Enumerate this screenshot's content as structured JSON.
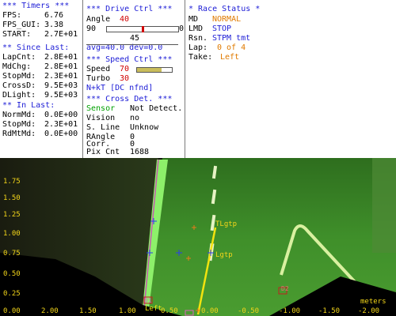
{
  "timers": {
    "header": "*** Timers ***",
    "fps_label": "FPS:",
    "fps": "6.76",
    "fps_gui_label": "FPS_GUI:",
    "fps_gui": "3.38",
    "start_label": "START:",
    "start": "2.7E+01"
  },
  "since_last": {
    "header": "** Since Last:",
    "items": [
      {
        "label": "LapCnt:",
        "value": "2.8E+01"
      },
      {
        "label": "MdChg:",
        "value": "2.8E+01"
      },
      {
        "label": "StopMd:",
        "value": "2.3E+01"
      },
      {
        "label": "CrossD:",
        "value": "9.5E+03"
      },
      {
        "label": "DLight:",
        "value": "9.5E+03"
      }
    ]
  },
  "in_last": {
    "header": "** In Last:",
    "items": [
      {
        "label": "NormMd:",
        "value": "0.0E+00"
      },
      {
        "label": "StopMd:",
        "value": "2.3E+01"
      },
      {
        "label": "RdMtMd:",
        "value": "0.0E+00"
      }
    ]
  },
  "drive": {
    "header": "*** Drive Ctrl ***",
    "angle_label": "Angle",
    "angle": "40",
    "slider_min": "90",
    "slider_max": "0",
    "slider_value": 45,
    "slider_center": "45",
    "avg_dev": "avg=40.0  dev=0.0"
  },
  "speed": {
    "header": "*** Speed Ctrl ***",
    "speed_label": "Speed",
    "speed": "70",
    "speed_fraction": 0.7,
    "turbo_label": "Turbo",
    "turbo": "30",
    "nkt": "N+kT [DC nfnd]"
  },
  "cross": {
    "header": "*** Cross Det. ***",
    "sensor_label": "Sensor",
    "sensor": "Not Detect.",
    "items": [
      {
        "label": "Vision",
        "value": "no"
      },
      {
        "label": "S. Line",
        "value": "Unknow"
      },
      {
        "label": "RAngle",
        "value": "0"
      },
      {
        "label": "Corr.",
        "value": "0"
      },
      {
        "label": "Pix Cnt",
        "value": "1688"
      }
    ]
  },
  "race": {
    "header": "* Race Status *",
    "md_label": "MD",
    "md": "NORMAL",
    "lmd_label": "LMD",
    "lmd": "STOP",
    "rsn_label": "Rsn.",
    "rsn": "STPM tmt",
    "lap_label": "Lap:",
    "lap": "0 of 4",
    "take_label": "Take:",
    "take": "Left"
  },
  "camera": {
    "y_ticks": [
      "1.75",
      "1.50",
      "1.25",
      "1.00",
      "0.75",
      "0.50",
      "0.25"
    ],
    "x_ticks": [
      "2.00",
      "1.50",
      "1.00",
      "0.50",
      "0.00",
      "-0.50",
      "-1.00",
      "-1.50",
      "-2.00"
    ],
    "bottom_left": "0.00",
    "x_unit": "meters",
    "labels": {
      "tl_gtp": "TLgtp",
      "l_gtp": "Lgtp",
      "left": "Left",
      "d1": "D1",
      "d2": "D2"
    }
  }
}
